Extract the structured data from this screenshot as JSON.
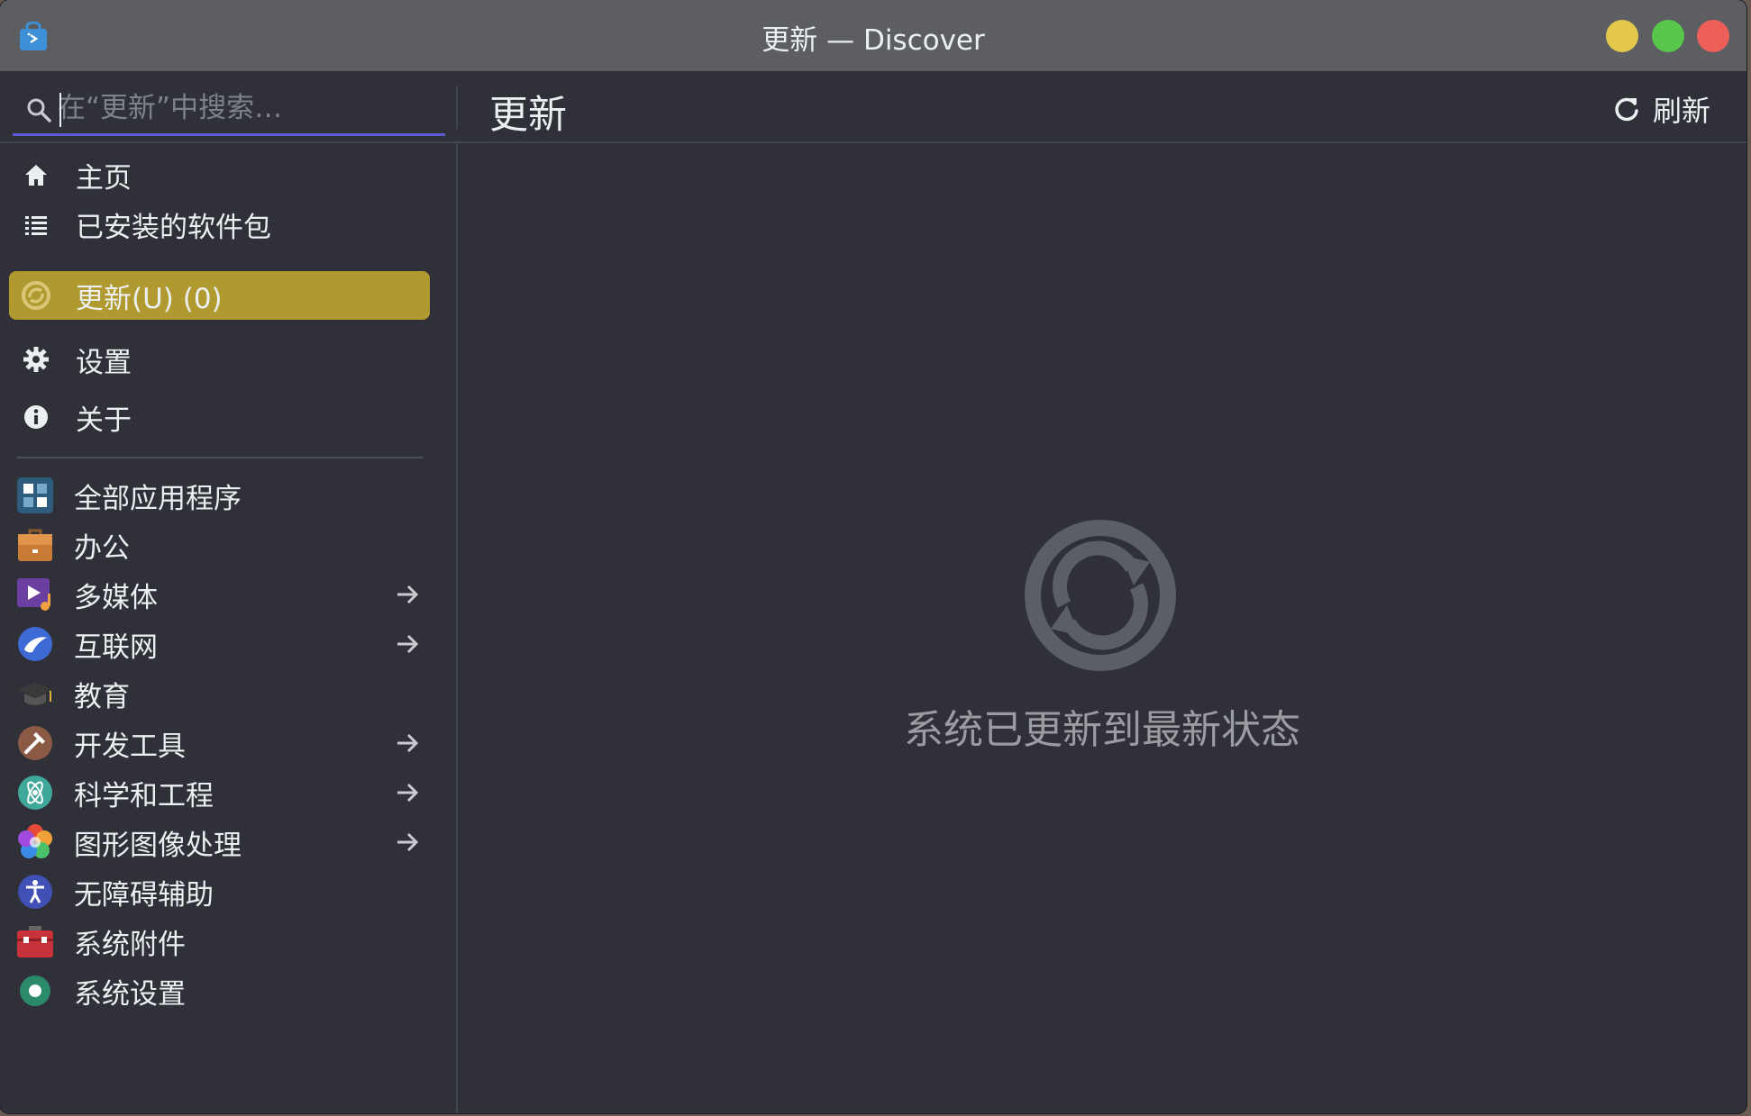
{
  "window": {
    "title": "更新 — Discover"
  },
  "search": {
    "placeholder": "在“更新”中搜索…",
    "value": ""
  },
  "header": {
    "page_title": "更新",
    "refresh_label": "刷新"
  },
  "sidebar": {
    "nav": [
      {
        "label": "主页",
        "icon": "home-icon"
      },
      {
        "label": "已安装的软件包",
        "icon": "list-icon"
      },
      {
        "label": "更新(U) (0)",
        "icon": "update-icon",
        "active": true
      },
      {
        "label": "设置",
        "icon": "gear-icon"
      },
      {
        "label": "关于",
        "icon": "info-icon"
      }
    ],
    "categories": [
      {
        "label": "全部应用程序",
        "icon": "all-apps-icon",
        "has_children": false
      },
      {
        "label": "办公",
        "icon": "office-icon",
        "has_children": false
      },
      {
        "label": "多媒体",
        "icon": "multimedia-icon",
        "has_children": true
      },
      {
        "label": "互联网",
        "icon": "internet-icon",
        "has_children": true
      },
      {
        "label": "教育",
        "icon": "education-icon",
        "has_children": false
      },
      {
        "label": "开发工具",
        "icon": "development-icon",
        "has_children": true
      },
      {
        "label": "科学和工程",
        "icon": "science-icon",
        "has_children": true
      },
      {
        "label": "图形图像处理",
        "icon": "graphics-icon",
        "has_children": true
      },
      {
        "label": "无障碍辅助",
        "icon": "accessibility-icon",
        "has_children": false
      },
      {
        "label": "系统附件",
        "icon": "utilities-icon",
        "has_children": false
      },
      {
        "label": "系统设置",
        "icon": "system-settings-icon",
        "has_children": false
      }
    ]
  },
  "main": {
    "status_text": "系统已更新到最新状态",
    "status_icon": "update-status-icon"
  },
  "colors": {
    "accent_active": "#b09a2f",
    "search_underline": "#5b5bd8",
    "background": "#2f3038"
  }
}
